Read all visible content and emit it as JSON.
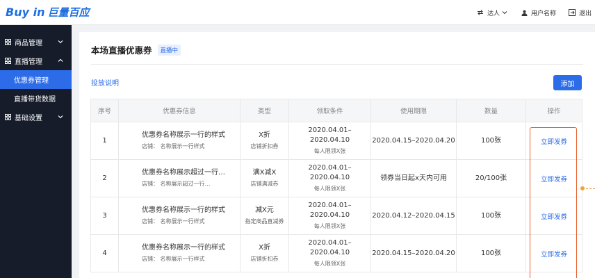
{
  "header": {
    "logo_text": "Buy in",
    "logo_cn": "巨量百应",
    "role_label": "达人",
    "user_label": "用户名称",
    "logout_label": "退出"
  },
  "sidebar": {
    "items": [
      {
        "label": "商品管理"
      },
      {
        "label": "直播管理"
      },
      {
        "label": "优惠券管理"
      },
      {
        "label": "直播带货数据"
      },
      {
        "label": "基础设置"
      }
    ]
  },
  "page": {
    "title": "本场直播优惠券",
    "badge": "直播中",
    "delivery_link": "投放说明",
    "add_button": "添加"
  },
  "table": {
    "headers": [
      "序号",
      "优惠券信息",
      "类型",
      "领取条件",
      "使用期限",
      "数量",
      "操作"
    ],
    "rows": [
      {
        "index": "1",
        "name": "优惠券名称展示一行的样式",
        "store": "店铺：  名称展示一行样式",
        "type": "X折",
        "type_sub": "店铺折扣券",
        "cond": "2020.04.01–2020.04.10",
        "cond_sub": "每人限领X张",
        "period": "2020.04.15–2020.04.20",
        "qty": "100张",
        "action": "立即发券"
      },
      {
        "index": "2",
        "name": "优惠券名称展示超过一行…",
        "store": "店铺：  名称展示超过一行…",
        "type": "满X减X",
        "type_sub": "店铺满减券",
        "cond": "2020.04.01–2020.04.10",
        "cond_sub": "每人限领X张",
        "period": "领券当日起x天内可用",
        "qty": "20/100张",
        "action": "立即发券"
      },
      {
        "index": "3",
        "name": "优惠券名称展示一行的样式",
        "store": "店铺：  名称展示一行样式",
        "type": "减X元",
        "type_sub": "指定商品直减券",
        "cond": "2020.04.01–2020.04.10",
        "cond_sub": "每人限领X张",
        "period": "2020.04.12–2020.04.15",
        "qty": "100张",
        "action": "立即发券"
      },
      {
        "index": "4",
        "name": "优惠券名称展示一行的样式",
        "store": "店铺：  名称展示一行样式",
        "type": "X折",
        "type_sub": "店铺折扣券",
        "cond": "2020.04.01–2020.04.10",
        "cond_sub": "每人限领X张",
        "period": "2020.04.15–2020.04.20",
        "qty": "100张",
        "action": "立即发券"
      }
    ]
  },
  "colors": {
    "accent": "#2c6ce8",
    "sidebar_bg": "#161c2a",
    "highlight": "#e65c2c"
  }
}
